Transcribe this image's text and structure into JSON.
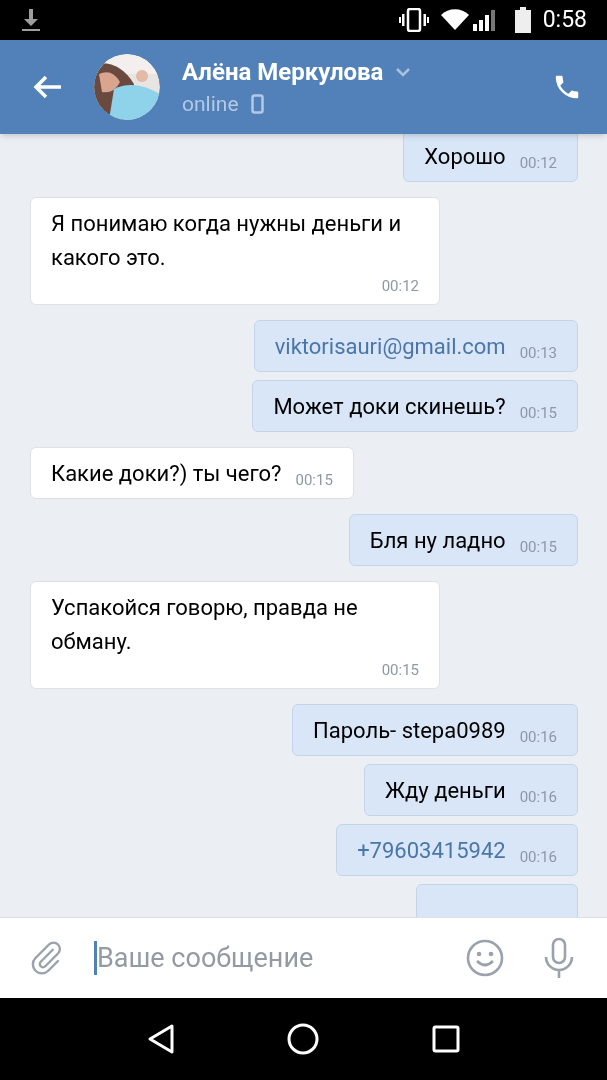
{
  "status_bar": {
    "time": "0:58"
  },
  "header": {
    "name": "Алёна Меркулова",
    "status": "online"
  },
  "messages": [
    {
      "out": true,
      "text": "Хорошо",
      "time": "00:12",
      "link": false
    },
    {
      "out": false,
      "text": "Я понимаю когда нужны деньги и какого это.",
      "time": "00:12",
      "link": false
    },
    {
      "out": true,
      "text": "viktorisauri@gmail.com",
      "time": "00:13",
      "link": true
    },
    {
      "out": true,
      "text": "Может доки скинешь?",
      "time": "00:15",
      "link": false
    },
    {
      "out": false,
      "text": "Какие доки?) ты чего?",
      "time": "00:15",
      "link": false
    },
    {
      "out": true,
      "text": "Бля ну ладно",
      "time": "00:15",
      "link": false
    },
    {
      "out": false,
      "text": "Успакойся говорю, правда не обману.",
      "time": "00:15",
      "link": false
    },
    {
      "out": true,
      "text": "Пароль- stepa0989",
      "time": "00:16",
      "link": false
    },
    {
      "out": true,
      "text": "Жду деньги",
      "time": "00:16",
      "link": false
    },
    {
      "out": true,
      "text": "+79603415942",
      "time": "00:16",
      "link": true
    }
  ],
  "composer": {
    "placeholder": "Ваше сообщение"
  }
}
